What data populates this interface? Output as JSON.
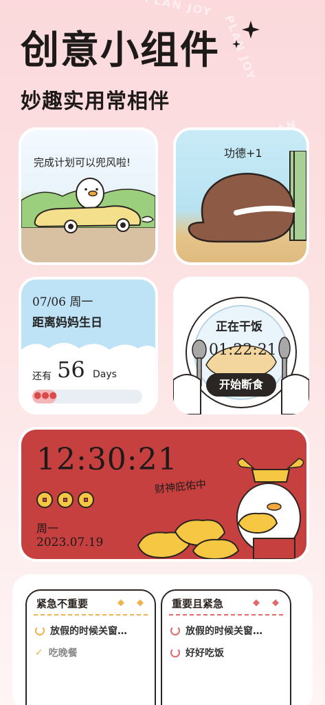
{
  "header": {
    "title": "创意小组件",
    "subtitle": "妙趣实用常相伴",
    "watermark": "PLAN JOY"
  },
  "widget_plan": {
    "caption": "完成计划可以兜风啦!"
  },
  "widget_merit": {
    "caption": "功德+1"
  },
  "widget_countdown": {
    "date": "07/06 周一",
    "event": "距离妈妈生日",
    "prefix": "还有",
    "days": "56",
    "unit": "Days",
    "progress": 0.22
  },
  "widget_fasting": {
    "status": "正在干饭",
    "timer": "01:22:21",
    "button": "开始断食"
  },
  "widget_clock": {
    "time": "12:30:21",
    "weekday": "周一",
    "date": "2023.07.19",
    "blessing": "财神庇佑中"
  },
  "todo_left": {
    "title": "紧急不重要",
    "items": [
      {
        "label": "放假的时候关窗…",
        "done": false
      },
      {
        "label": "吃晚餐",
        "done": true
      }
    ],
    "accent": "#f0b24a"
  },
  "todo_right": {
    "title": "重要且紧急",
    "items": [
      {
        "label": "放假的时候关窗…",
        "done": false
      },
      {
        "label": "好好吃饭",
        "done": false
      }
    ],
    "accent": "#e06a6a"
  }
}
